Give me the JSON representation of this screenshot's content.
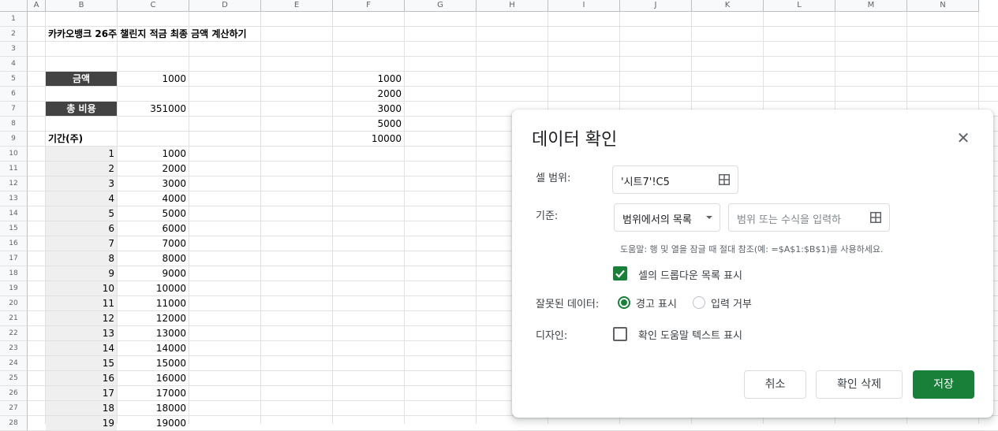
{
  "sheet": {
    "columns": [
      "A",
      "B",
      "C",
      "D",
      "E",
      "F",
      "G",
      "H",
      "I",
      "J",
      "K",
      "L",
      "M",
      "N"
    ],
    "rows": [
      "1",
      "2",
      "3",
      "4",
      "5",
      "6",
      "7",
      "8",
      "9",
      "10",
      "11",
      "12",
      "13",
      "14",
      "15",
      "16",
      "17",
      "18",
      "19",
      "20",
      "21",
      "22",
      "23",
      "24",
      "25",
      "26",
      "27",
      "28"
    ],
    "title": "카카오뱅크 26주 챌린지 적금 최종 금액 계산하기",
    "amount_label": "금액",
    "amount_value": "1000",
    "total_label": "총 비용",
    "total_value": "351000",
    "period_label": "기간(주)",
    "list_values": [
      "1000",
      "2000",
      "3000",
      "5000",
      "10000"
    ],
    "weeks": [
      "1",
      "2",
      "3",
      "4",
      "5",
      "6",
      "7",
      "8",
      "9",
      "10",
      "11",
      "12",
      "13",
      "14",
      "15",
      "16",
      "17",
      "18",
      "19"
    ],
    "week_amounts": [
      "1000",
      "2000",
      "3000",
      "4000",
      "5000",
      "6000",
      "7000",
      "8000",
      "9000",
      "10000",
      "11000",
      "12000",
      "13000",
      "14000",
      "15000",
      "16000",
      "17000",
      "18000",
      "19000"
    ]
  },
  "dialog": {
    "title": "데이터 확인",
    "range_label": "셀 범위:",
    "range_value": "'시트7'!C5",
    "criteria_label": "기준:",
    "criteria_option": "범위에서의 목록",
    "criteria_placeholder": "범위 또는 수식을 입력하",
    "help_text": "도움말: 행 및 열을 잠글 때 절대 참조(예: =$A$1:$B$1)를 사용하세요.",
    "show_dropdown_label": "셀의 드롭다운 목록 표시",
    "show_dropdown_checked": true,
    "invalid_label": "잘못된 데이터:",
    "invalid_warn": "경고 표시",
    "invalid_reject": "입력 거부",
    "invalid_selected": "경고 표시",
    "design_label": "디자인:",
    "design_help_label": "확인 도움말 텍스트 표시",
    "design_help_checked": false,
    "cancel": "취소",
    "remove": "확인 삭제",
    "save": "저장",
    "accent_color": "#188038",
    "icons": [
      "close-icon",
      "grid-range-icon",
      "dropdown-caret-icon",
      "checkbox-checked-icon",
      "checkbox-unchecked-icon",
      "radio-selected-icon",
      "radio-unselected-icon"
    ]
  }
}
